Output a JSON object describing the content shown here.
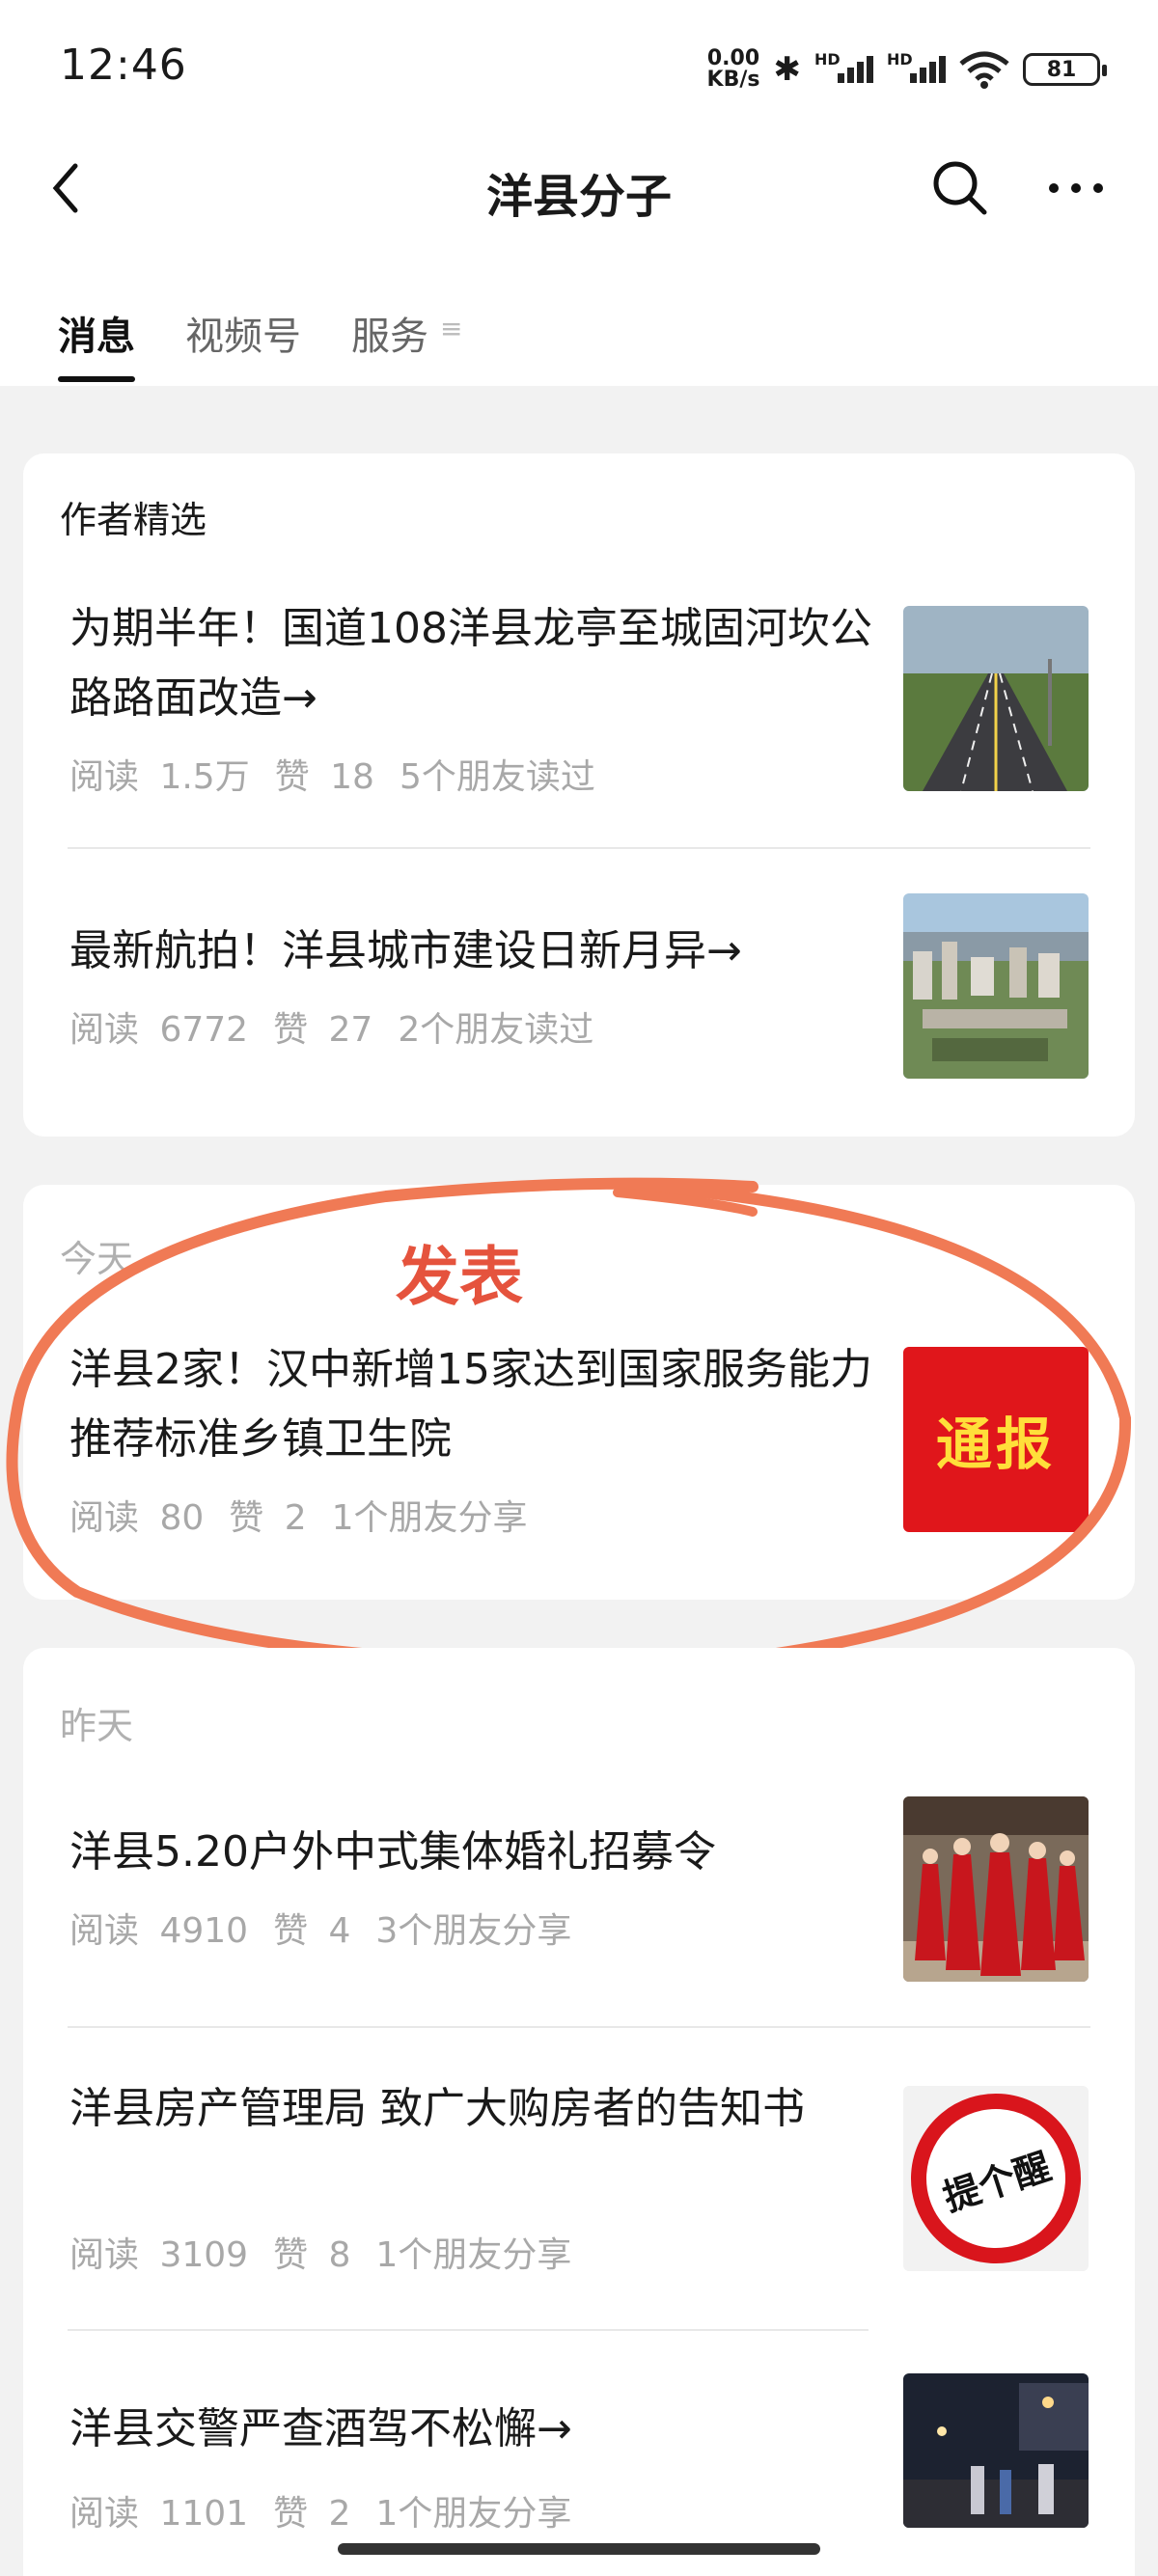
{
  "status_bar": {
    "time": "12:46",
    "net_speed_value": "0.00",
    "net_speed_unit": "KB/s",
    "signal_label_1": "HD",
    "signal_label_2": "HD",
    "battery": "81"
  },
  "nav": {
    "title": "洋县分子"
  },
  "tabs": [
    {
      "label": "消息"
    },
    {
      "label": "视频号"
    },
    {
      "label": "服务"
    }
  ],
  "sections": [
    {
      "header": "作者精选",
      "articles": [
        {
          "title": "为期半年！国道108洋县龙亭至城固河坎公路路面改造→",
          "reads": "阅读 1.5万",
          "likes": "赞 18",
          "friends": "5个朋友读过",
          "thumb_icon": "highway-photo"
        },
        {
          "title": "最新航拍！洋县城市建设日新月异→",
          "reads": "阅读 6772",
          "likes": "赞 27",
          "friends": "2个朋友读过",
          "thumb_icon": "city-aerial-photo"
        }
      ]
    },
    {
      "header": "今天",
      "articles": [
        {
          "title": "洋县2家！汉中新增15家达到国家服务能力推荐标准乡镇卫生院",
          "reads": "阅读 80",
          "likes": "赞 2",
          "friends": "1个朋友分享",
          "thumb_text": "通报"
        }
      ]
    },
    {
      "header": "昨天",
      "articles": [
        {
          "title": "洋县5.20户外中式集体婚礼招募令",
          "reads": "阅读 4910",
          "likes": "赞 4",
          "friends": "3个朋友分享",
          "thumb_icon": "wedding-photo"
        },
        {
          "title": "洋县房产管理局 致广大购房者的告知书",
          "reads": "阅读 3109",
          "likes": "赞 8",
          "friends": "1个朋友分享",
          "thumb_text": "提个醒"
        },
        {
          "title": "洋县交警严查酒驾不松懈→",
          "reads": "阅读 1101",
          "likes": "赞 2",
          "friends": "1个朋友分享",
          "thumb_icon": "night-street-photo"
        }
      ]
    }
  ],
  "annotation": {
    "text": "发表",
    "color": "#e5533d"
  },
  "colors": {
    "accent_red": "#e5533d",
    "meta_gray": "#a8a8a8",
    "background": "#f2f2f2"
  }
}
